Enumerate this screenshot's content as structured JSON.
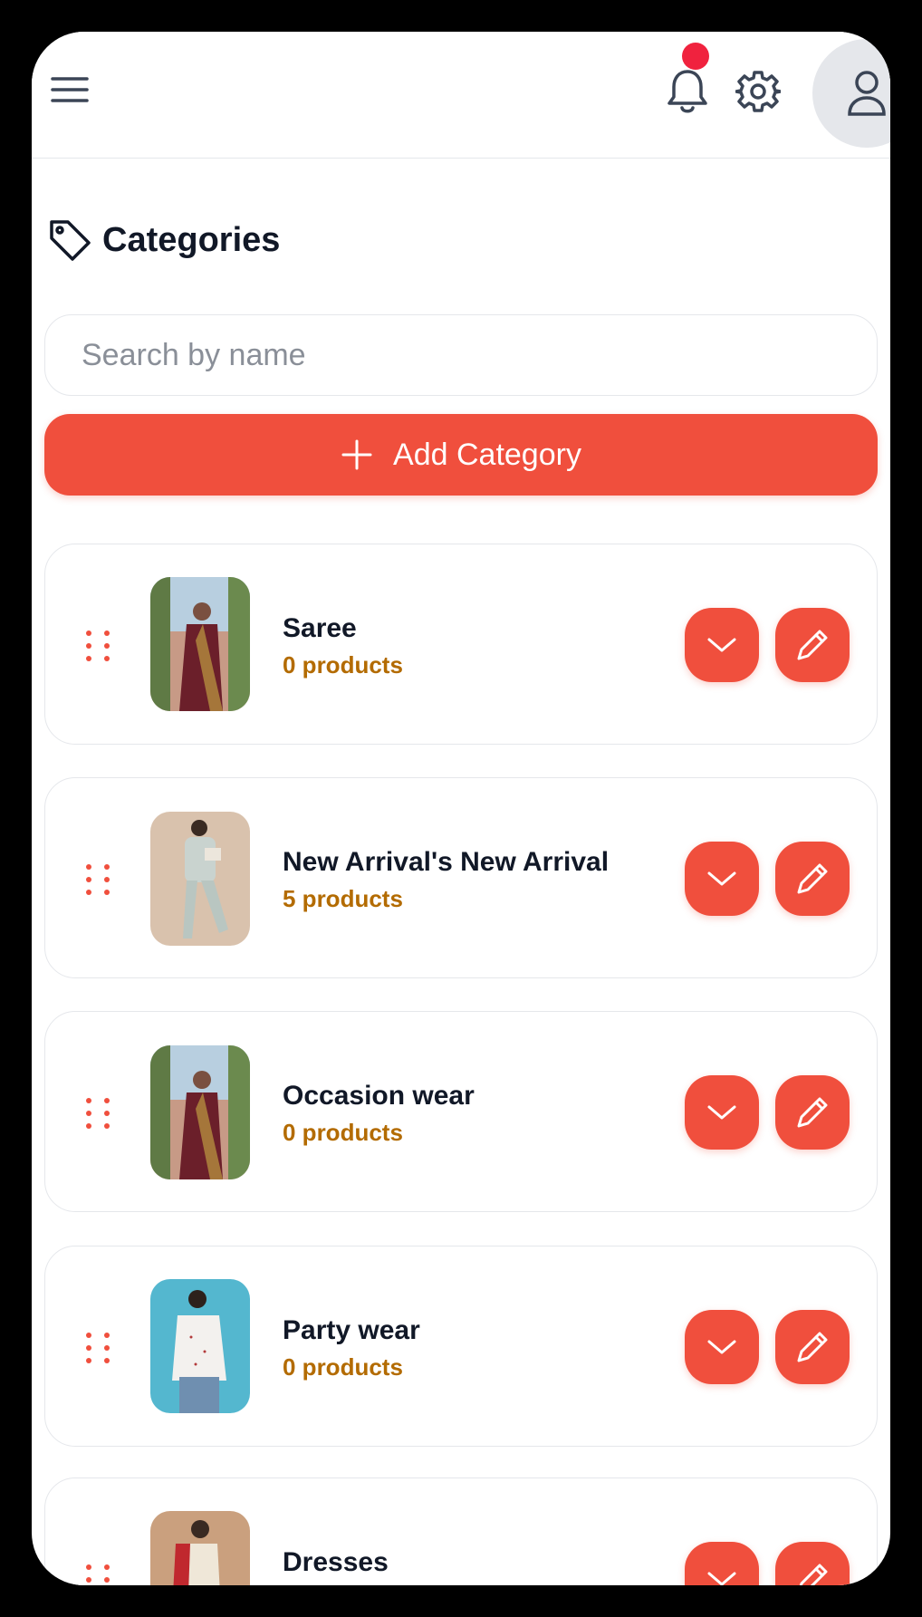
{
  "header": {
    "menu_icon": "hamburger-menu-icon",
    "bell_icon": "bell-icon",
    "settings_icon": "gear-icon",
    "profile_icon": "user-icon",
    "notification_dot_color": "#f0223e"
  },
  "page": {
    "title": "Categories",
    "title_icon": "tag-icon"
  },
  "search": {
    "value": "",
    "placeholder": "Search by name"
  },
  "add_button": {
    "label": "Add Category",
    "icon": "plus-icon"
  },
  "colors": {
    "accent": "#f04f3d",
    "count_text": "#b36b00",
    "title_text": "#111827",
    "border": "#e5e7eb"
  },
  "categories": [
    {
      "name": "Saree",
      "count": "0 products"
    },
    {
      "name": "New Arrival's New Arrival",
      "count": "5 products"
    },
    {
      "name": "Occasion wear",
      "count": "0 products"
    },
    {
      "name": "Party wear",
      "count": "0 products"
    },
    {
      "name": "Dresses",
      "count": ""
    }
  ]
}
